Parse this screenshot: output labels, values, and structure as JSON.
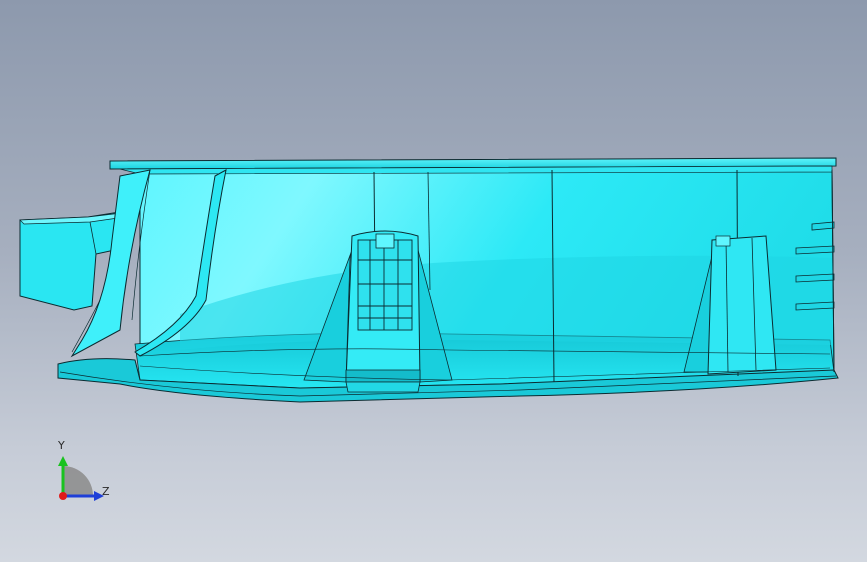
{
  "viewport": {
    "background_top": "#8d99ad",
    "background_bottom": "#d3d8e0"
  },
  "model": {
    "name": "cad-part-shell",
    "face_color": "#26e6f2",
    "highlight_color": "#7ff8ff",
    "shadow_color": "#15b9c9",
    "edge_color": "#0b2b31"
  },
  "triad": {
    "y_label": "Y",
    "z_label": "Z",
    "y_color": "#19c21f",
    "z_color": "#1e3fd8",
    "x_color": "#e01b1b",
    "icon": "axis-triad-icon"
  }
}
